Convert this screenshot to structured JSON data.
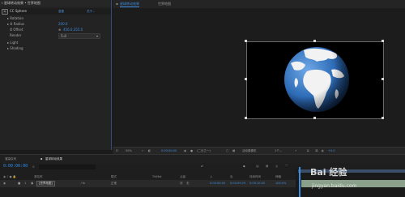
{
  "effect_panel": {
    "tab_label": "星球转动效果 • 世界地图",
    "effect_name": "CC Sphere",
    "reset_label": "重置",
    "about_label": "关于...",
    "props": {
      "rotation": "Rotation",
      "radius": "Radius",
      "radius_value": "200.0",
      "offset": "Offset",
      "offset_value": "456.0,355.0",
      "render": "Render",
      "render_value": "Full",
      "light": "Light",
      "shading": "Shading"
    }
  },
  "viewer": {
    "tab_active": "星球转动效果",
    "tab_other": "世界地图",
    "toolbar": {
      "zoom": "50%",
      "timecode": "0:00:00:00",
      "resolution": "(二分之一)",
      "camera": "活动摄像机",
      "views": "1个...",
      "exposure": "+0.0"
    }
  },
  "timeline": {
    "tab_render": "渲染队列",
    "tab_comp": "星球转动效果",
    "timecode": "0:00:00:00",
    "col_source": "源名称",
    "col_mode": "模式",
    "col_trkmat": "TrkMat",
    "col_parent": "父级",
    "col_in": "入",
    "col_out": "出",
    "col_duration": "持续时间",
    "col_stretch": "伸缩",
    "layer": {
      "number": "1",
      "name": "[世界地图]",
      "mode": "正常",
      "parent": "无",
      "in": "0:00:00:00",
      "out": "0:00:09:29",
      "duration": "0:00:10:00",
      "stretch": "100.0%"
    }
  },
  "watermark": {
    "brand": "Bai 经验",
    "url": "jingyan.baidu.com"
  },
  "colors": {
    "accent": "#3d8ee0",
    "panel": "#232323",
    "layer_bar": "#8aa08a"
  }
}
